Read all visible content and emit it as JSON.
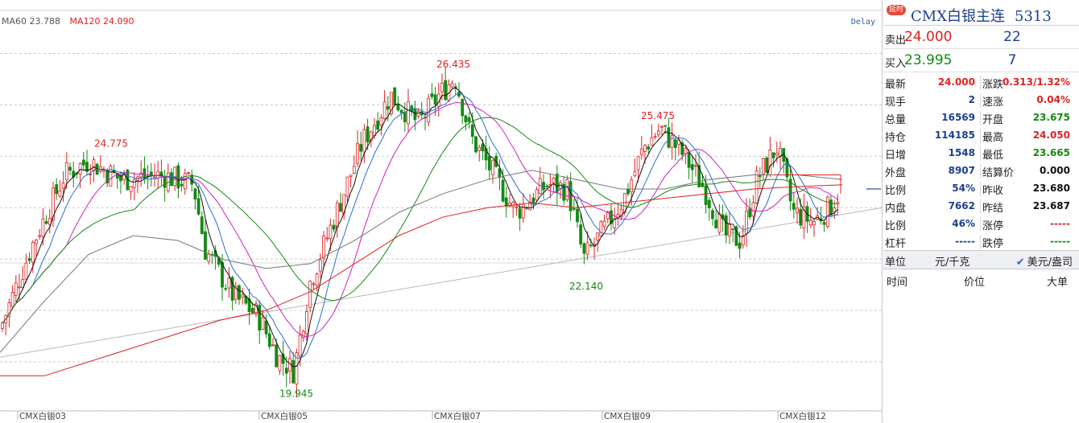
{
  "legend": {
    "ma60": "MA60 23.788",
    "ma120": "MA120 24.090",
    "ma60_color": "#555555",
    "ma120_color": "#e02020"
  },
  "delay_label": "Delay",
  "panel": {
    "badge": "延时",
    "name": "CMX白银主连",
    "code": "5313",
    "sell": {
      "label": "卖出",
      "price": "24.000",
      "volume": "22"
    },
    "buy": {
      "label": "买入",
      "price": "23.995",
      "volume": "7"
    },
    "stats": [
      {
        "lk": "最新",
        "lv": "24.000",
        "lc": "red",
        "rk": "涨跌",
        "rv": "0.313/1.32%",
        "rc": "red"
      },
      {
        "lk": "现手",
        "lv": "2",
        "lc": "blue",
        "rk": "速涨",
        "rv": "0.04%",
        "rc": "red"
      },
      {
        "lk": "总量",
        "lv": "16569",
        "lc": "blue",
        "rk": "开盘",
        "rv": "23.675",
        "rc": "green"
      },
      {
        "lk": "持仓",
        "lv": "114185",
        "lc": "blue",
        "rk": "最高",
        "rv": "24.050",
        "rc": "red"
      },
      {
        "lk": "日增",
        "lv": "1548",
        "lc": "blue",
        "rk": "最低",
        "rv": "23.665",
        "rc": "green"
      },
      {
        "lk": "外盘",
        "lv": "8907",
        "lc": "blue",
        "rk": "结算价",
        "rv": "0.000",
        "rc": "black"
      },
      {
        "lk": "比例",
        "lv": "54%",
        "lc": "blue",
        "rk": "昨收",
        "rv": "23.680",
        "rc": "black"
      },
      {
        "lk": "内盘",
        "lv": "7662",
        "lc": "blue",
        "rk": "昨结",
        "rv": "23.687",
        "rc": "black"
      },
      {
        "lk": "比例",
        "lv": "46%",
        "lc": "blue",
        "rk": "涨停",
        "rv": "-----",
        "rc": "red"
      },
      {
        "lk": "杠杆",
        "lv": "-----",
        "lc": "blue",
        "rk": "跌停",
        "rv": "-----",
        "rc": "green"
      }
    ],
    "unit_label": "单位",
    "unit_value": "元/千克",
    "unit_alt": "美元/盎司",
    "ticks_header": {
      "time": "时间",
      "price": "价位",
      "big": "大单"
    }
  },
  "chart_data": {
    "type": "line",
    "ylim": [
      19.3,
      27.7
    ],
    "grid": "horizontal dashed",
    "x_labels": [
      "CMX白银03",
      "CMX白银05",
      "CMX白银07",
      "CMX白银09",
      "CMX白银12"
    ],
    "annotations": [
      {
        "text": "24.775",
        "kind": "high"
      },
      {
        "text": "26.435",
        "kind": "high"
      },
      {
        "text": "25.475",
        "kind": "high"
      },
      {
        "text": "19.945",
        "kind": "low"
      },
      {
        "text": "22.140",
        "kind": "low"
      }
    ],
    "series": [
      {
        "name": "MA60",
        "color": "#777777",
        "values": [
          20.5,
          21.6,
          22.6,
          23.0,
          22.9,
          22.5,
          22.3,
          22.4,
          22.9,
          23.5,
          23.9,
          24.2,
          24.4,
          24.2,
          24.0,
          24.0,
          24.2,
          24.3,
          24.3,
          24.2
        ]
      },
      {
        "name": "MA120",
        "color": "#e02020",
        "values": [
          20.0,
          20.0,
          20.3,
          20.6,
          20.9,
          21.2,
          21.4,
          21.8,
          22.4,
          23.0,
          23.4,
          23.6,
          23.7,
          23.6,
          23.7,
          23.8,
          23.9,
          24.0,
          24.05,
          24.09
        ]
      }
    ],
    "trendline": {
      "from": 20.4,
      "to": 23.6
    }
  }
}
